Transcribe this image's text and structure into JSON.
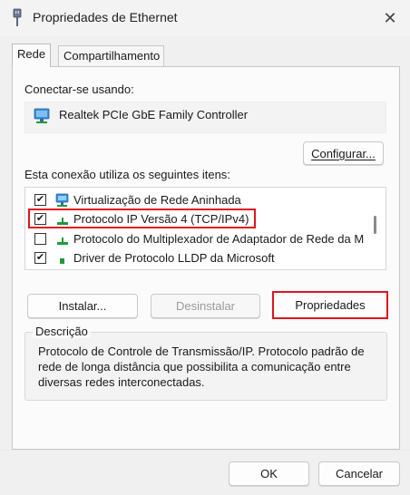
{
  "window": {
    "title": "Propriedades de Ethernet",
    "close_glyph": "✕"
  },
  "tabs": [
    {
      "label": "Rede",
      "active": true
    },
    {
      "label": "Compartilhamento",
      "active": false
    }
  ],
  "connect_using": {
    "label": "Conectar-se usando:",
    "adapter": "Realtek PCIe GbE Family Controller",
    "configure_button": "Configurar..."
  },
  "items_section": {
    "label": "Esta conexão utiliza os seguintes itens:",
    "items": [
      {
        "label": "Virtualização de Rede Aninhada",
        "checked": true,
        "icon": "network-adapter-icon",
        "highlighted": false
      },
      {
        "label": "Protocolo IP Versão 4 (TCP/IPv4)",
        "checked": true,
        "icon": "protocol-icon",
        "highlighted": true
      },
      {
        "label": "Protocolo do Multiplexador de Adaptador de Rede da M",
        "checked": false,
        "icon": "protocol-icon",
        "highlighted": false
      },
      {
        "label": "Driver de Protocolo LLDP da Microsoft",
        "checked": true,
        "icon": "protocol-icon",
        "highlighted": false
      }
    ]
  },
  "actions": {
    "install": "Instalar...",
    "uninstall": "Desinstalar",
    "properties": "Propriedades"
  },
  "description": {
    "legend": "Descrição",
    "text": "Protocolo de Controle de Transmissão/IP. Protocolo padrão de rede de longa distância que possibilita a comunicação entre diversas redes interconectadas."
  },
  "footer": {
    "ok": "OK",
    "cancel": "Cancelar"
  },
  "colors": {
    "highlight": "#e0141e",
    "icon_green": "#1e9b3c",
    "icon_blue": "#2a7fd0"
  }
}
